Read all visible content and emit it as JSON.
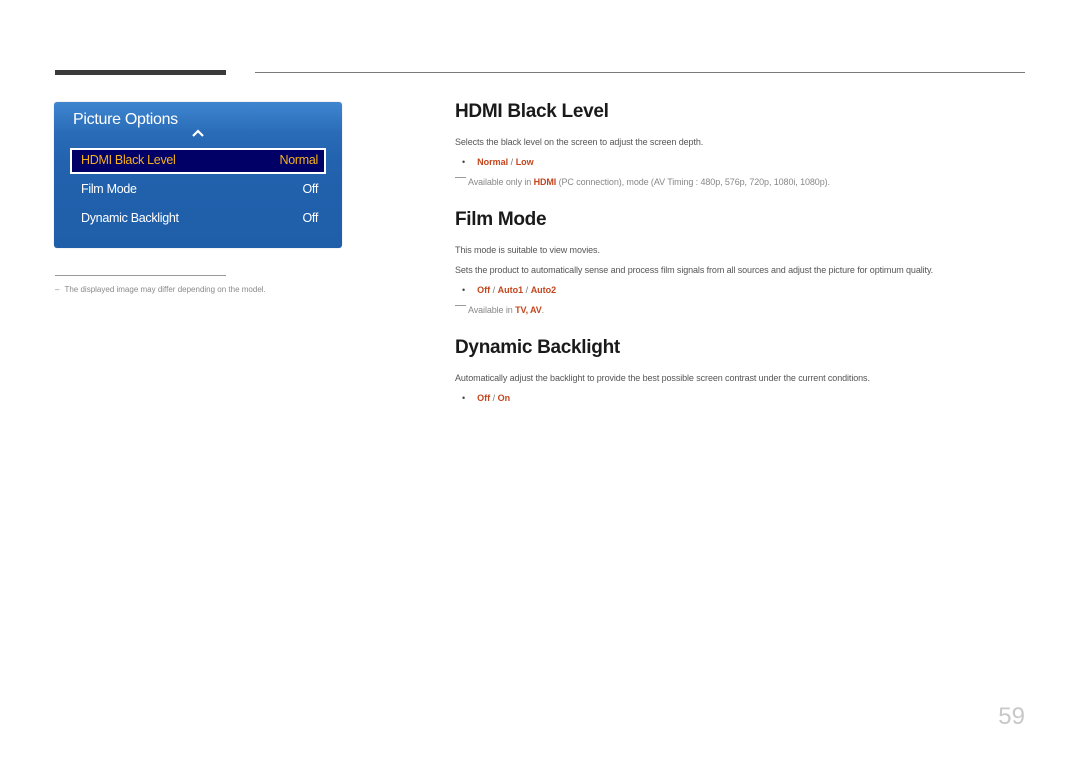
{
  "osd": {
    "title": "Picture Options",
    "items": [
      {
        "label": "HDMI Black Level",
        "value": "Normal",
        "selected": true
      },
      {
        "label": "Film Mode",
        "value": "Off",
        "selected": false
      },
      {
        "label": "Dynamic Backlight",
        "value": "Off",
        "selected": false
      }
    ],
    "colors": {
      "panel": "#2262ae",
      "selected_bg": "#000066",
      "selected_text": "#f5b21d"
    }
  },
  "footnote": {
    "dash": "–",
    "text": "The displayed image may differ depending on the model."
  },
  "sections": {
    "hdmi": {
      "title": "HDMI Black Level",
      "description": "Selects the black level on the screen to adjust the screen depth.",
      "options": [
        "Normal",
        "Low"
      ],
      "separator": " / ",
      "note_prefix": "Available only in ",
      "note_highlight": "HDMI",
      "note_suffix": " (PC connection), mode (AV Timing : 480p, 576p, 720p, 1080i, 1080p)."
    },
    "film": {
      "title": "Film Mode",
      "description1": "This mode is suitable to view movies.",
      "description2": "Sets the product to automatically sense and process film signals from all sources and adjust the picture for optimum quality.",
      "options": [
        "Off",
        "Auto1",
        "Auto2"
      ],
      "separator": " / ",
      "note_prefix": "Available in ",
      "note_highlight1": "TV",
      "note_comma": ", ",
      "note_highlight2": "AV",
      "note_suffix": "."
    },
    "backlight": {
      "title": "Dynamic Backlight",
      "description": "Automatically adjust the backlight to provide the best possible screen contrast under the current conditions.",
      "options": [
        "Off",
        "On"
      ],
      "separator": " / "
    }
  },
  "bullet_char": "•",
  "accent_color": "#c3461e",
  "page_number": "59"
}
